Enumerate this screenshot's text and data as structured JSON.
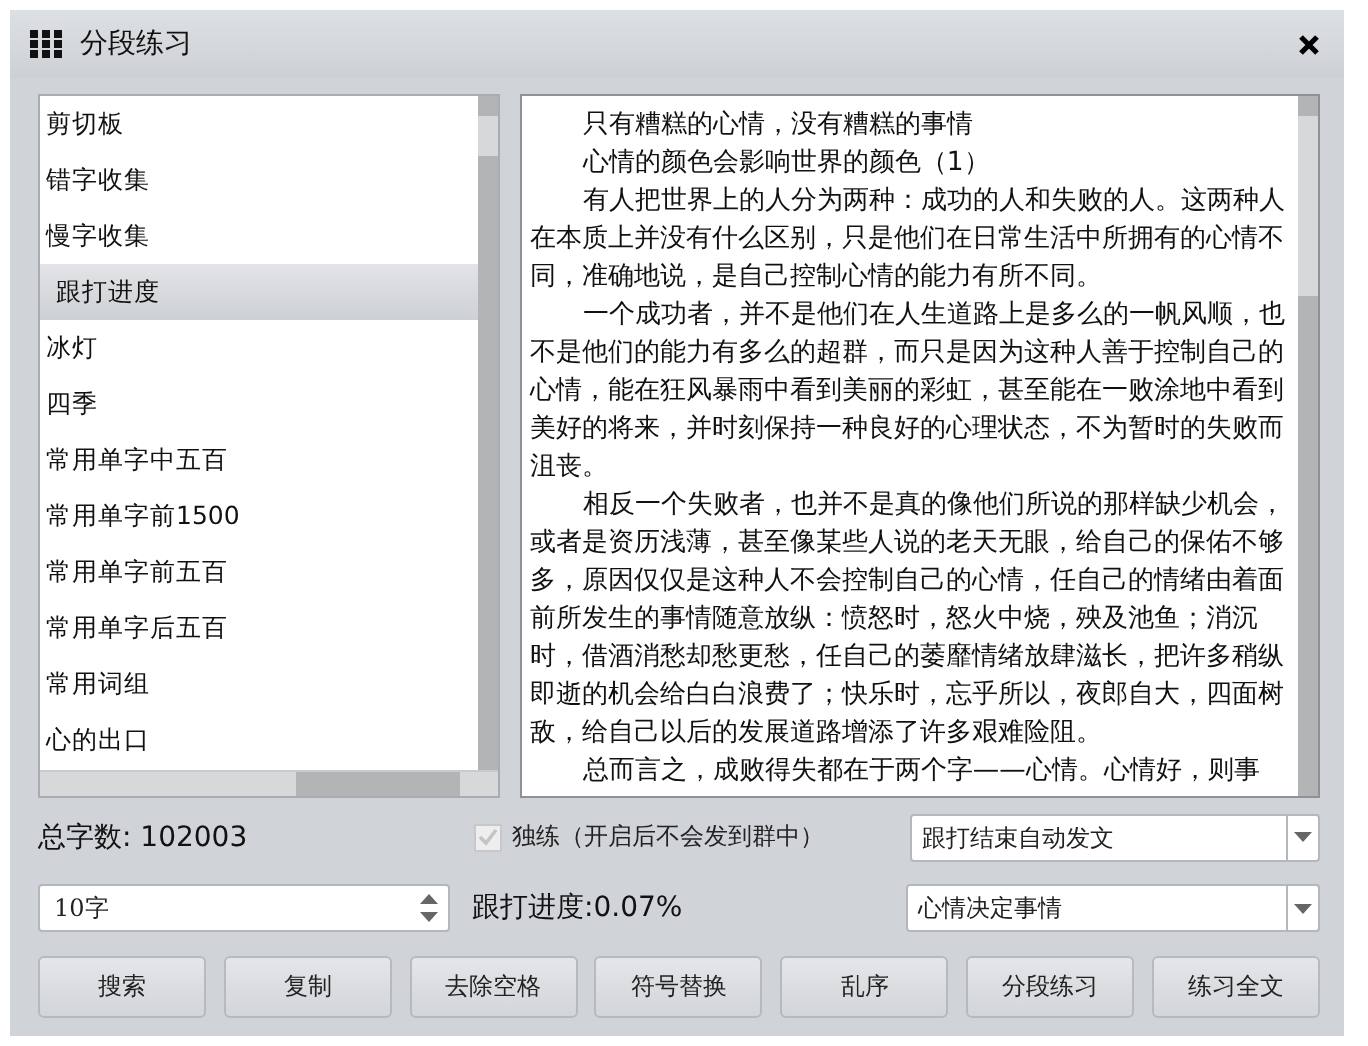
{
  "window": {
    "title": "分段练习"
  },
  "list": {
    "items": [
      {
        "label": "剪切板",
        "selected": false
      },
      {
        "label": "错字收集",
        "selected": false
      },
      {
        "label": "慢字收集",
        "selected": false
      },
      {
        "label": "跟打进度",
        "selected": true
      },
      {
        "label": "冰灯",
        "selected": false
      },
      {
        "label": "四季",
        "selected": false
      },
      {
        "label": "常用单字中五百",
        "selected": false
      },
      {
        "label": "常用单字前1500",
        "selected": false
      },
      {
        "label": "常用单字前五百",
        "selected": false
      },
      {
        "label": "常用单字后五百",
        "selected": false
      },
      {
        "label": "常用词组",
        "selected": false
      },
      {
        "label": "心的出口",
        "selected": false
      }
    ]
  },
  "text_panel": {
    "paragraphs": [
      "只有糟糕的心情，没有糟糕的事情",
      "心情的颜色会影响世界的颜色（1）",
      "有人把世界上的人分为两种：成功的人和失败的人。这两种人在本质上并没有什么区别，只是他们在日常生活中所拥有的心情不同，准确地说，是自己控制心情的能力有所不同。",
      "一个成功者，并不是他们在人生道路上是多么的一帆风顺，也不是他们的能力有多么的超群，而只是因为这种人善于控制自己的心情，能在狂风暴雨中看到美丽的彩虹，甚至能在一败涂地中看到美好的将来，并时刻保持一种良好的心理状态，不为暂时的失败而沮丧。",
      "相反一个失败者，也并不是真的像他们所说的那样缺少机会，或者是资历浅薄，甚至像某些人说的老天无眼，给自己的保佑不够多，原因仅仅是这种人不会控制自己的心情，任自己的情绪由着面前所发生的事情随意放纵：愤怒时，怒火中烧，殃及池鱼；消沉时，借酒消愁却愁更愁，任自己的萎靡情绪放肆滋长，把许多稍纵即逝的机会给白白浪费了；快乐时，忘乎所以，夜郎自大，四面树敌，给自己以后的发展道路增添了许多艰难险阻。",
      "总而言之，成败得失都在于两个字——心情。心情好，则事"
    ]
  },
  "total_count": "总字数: 102003",
  "solo": {
    "label": "独练（开启后不会发到群中）",
    "checked": true,
    "disabled": true
  },
  "auto_send_select": {
    "value": "跟打结束自动发文"
  },
  "segment_size": {
    "value": "10字"
  },
  "progress": "跟打进度:0.07%",
  "article_select": {
    "value": "心情决定事情"
  },
  "buttons": [
    "搜索",
    "复制",
    "去除空格",
    "符号替换",
    "乱序",
    "分段练习",
    "练习全文"
  ]
}
